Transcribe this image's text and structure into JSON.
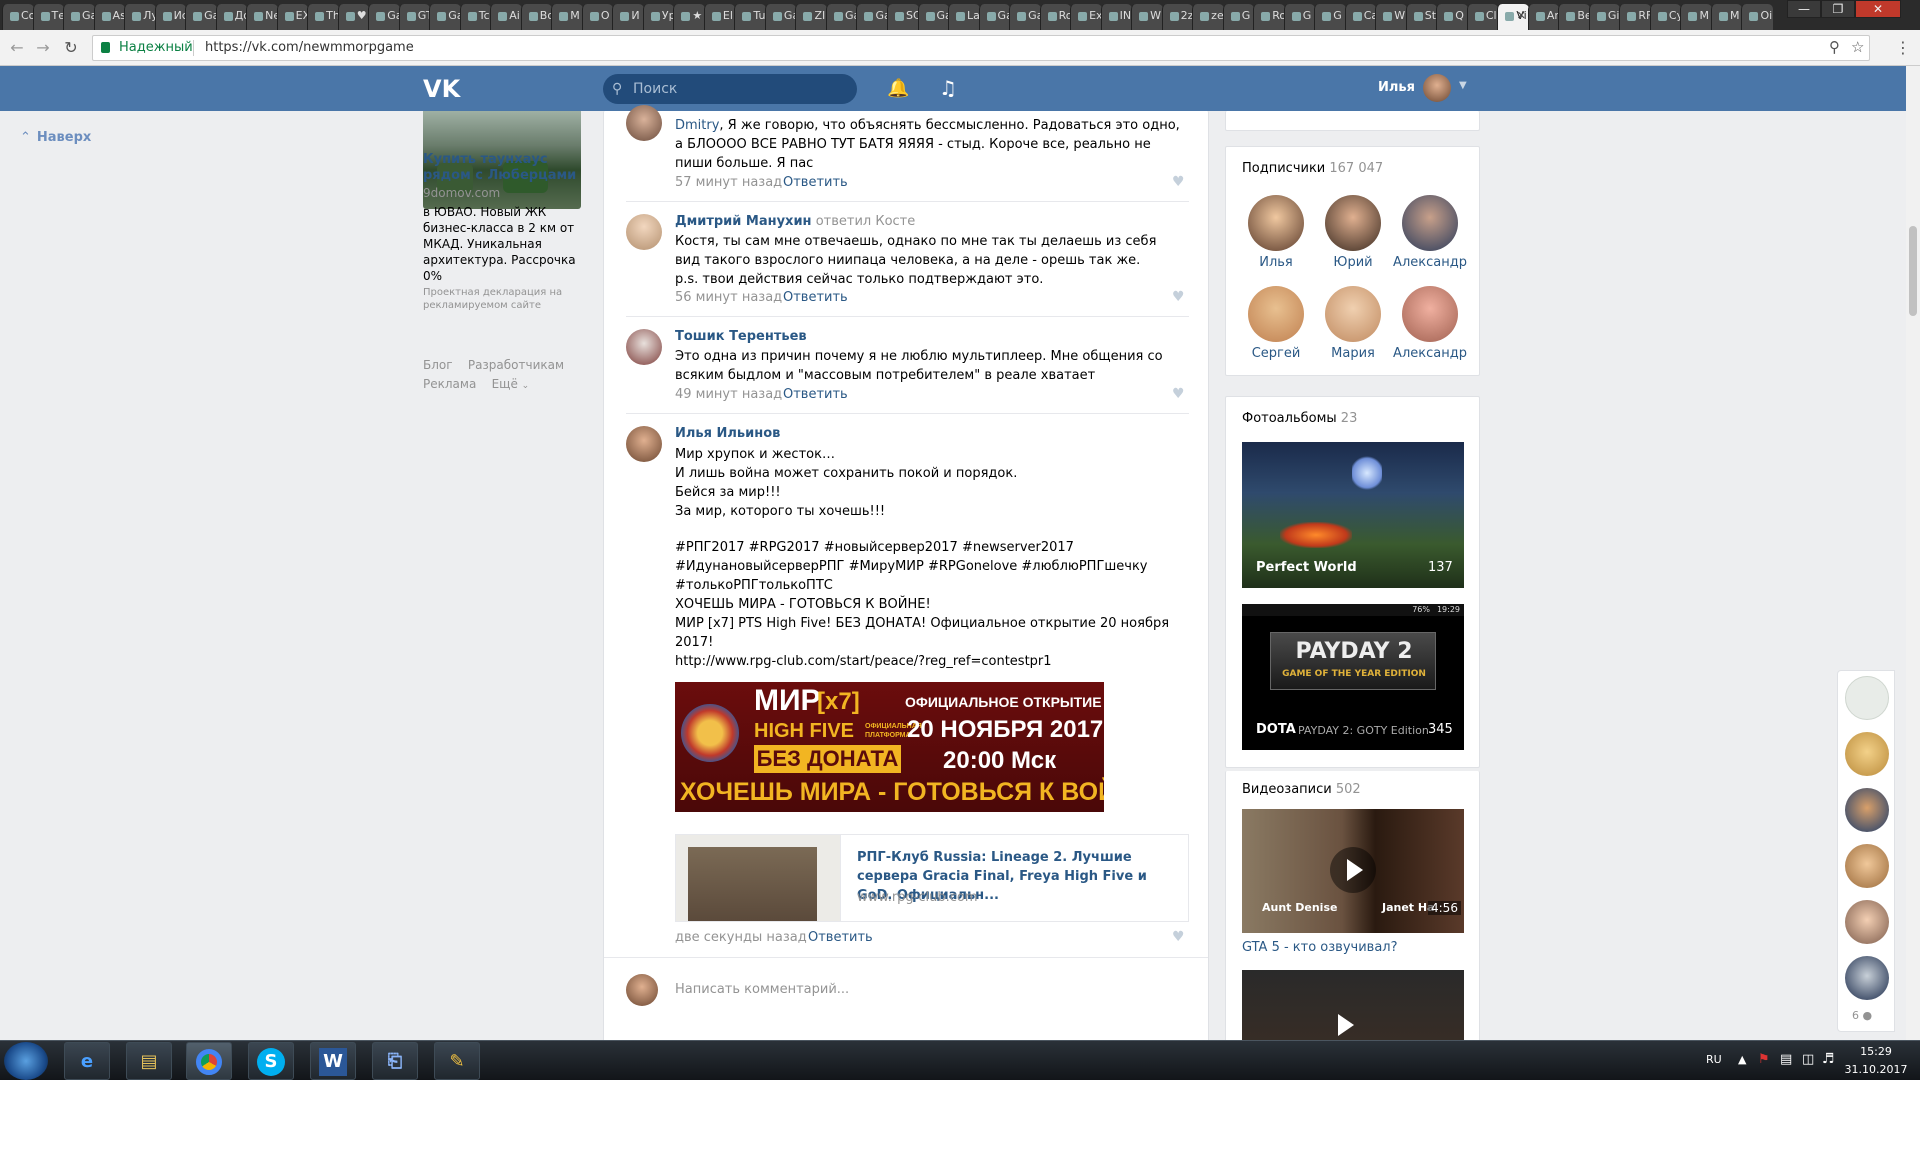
{
  "browser": {
    "tabs": [
      "Со",
      "Те",
      "Ga",
      "As",
      "Лу",
      "Ис",
      "Ga",
      "До",
      "Ne",
      "EX",
      "Th",
      "♥",
      "Ga",
      "GT",
      "Ga",
      "Tc",
      "Ai",
      "Bo",
      "M",
      "O",
      "И",
      "Ур",
      "★",
      "El",
      "Tu",
      "Ga",
      "ZI",
      "Ga",
      "Ga",
      "SC",
      "Ga",
      "La",
      "Ga",
      "Ga",
      "Ro",
      "Ex",
      "IN",
      "W",
      "2z",
      "ze",
      "G",
      "Ro",
      "G",
      "G",
      "Ca",
      "W",
      "St",
      "Q",
      "Cl",
      "Vi",
      "Ar",
      "Be",
      "Gi",
      "RF",
      "Cy",
      "M",
      "M",
      "Oi"
    ],
    "active_tab_index": 49,
    "secure_label": "Надежный",
    "url": "https://vk.com/newmmorpgame",
    "icons": {
      "back": "back-arrow-icon",
      "forward": "forward-arrow-icon",
      "reload": "reload-icon",
      "zoom": "zoom-icon",
      "star": "bookmark-star-icon",
      "menu": "menu-dots-icon"
    }
  },
  "vk": {
    "header": {
      "search_placeholder": "Поиск",
      "user_name": "Илья"
    },
    "back_to_top": "Наверх",
    "ad": {
      "title": "Купить таунхаус рядом с Люберцами",
      "domain": "9domov.com",
      "text": "в ЮВАО. Новый ЖК бизнес-класса в 2 км от МКАД. Уникальная архитектура. Рассрочка 0%",
      "disclaimer": "Проектная декларация на рекламируемом сайте"
    },
    "footer_links": [
      "Блог",
      "Разработчикам",
      "Реклама",
      "Ещё"
    ],
    "comments": [
      {
        "author": "Dmitry",
        "text_rest": ", Я же говорю, что объяснять бессмысленно. Радоваться это одно, а БЛОООО ВСЕ РАВНО ТУТ БАТЯ ЯЯЯЯ - стыд. Короче все, реально не пиши больше. Я пас",
        "time": "57 минут назад",
        "reply": "Ответить"
      },
      {
        "author": "Дмитрий Манухин",
        "replied": "ответил Косте",
        "text": "Костя, ты сам мне отвечаешь, однако по мне так ты делаешь из себя вид такого взрослого ниипаца человека, а на деле - орешь так же.",
        "ps": "p.s. твои действия сейчас только подтверждают это.",
        "time": "56 минут назад",
        "reply": "Ответить"
      },
      {
        "author": "Тошик Терентьев",
        "text": "Это одна из причин почему я не люблю мультиплеер. Мне общения со всяким быдлом и \"массовым потребителем\" в реале хватает",
        "time": "49 минут назад",
        "reply": "Ответить"
      },
      {
        "author": "Илья Ильинов",
        "lines": [
          "Мир хрупок и жесток…",
          "И лишь война может сохранить покой и порядок.",
          "Бейся за мир!!!",
          "За мир, которого ты хочешь!!!"
        ],
        "hashtags": "#РПГ2017 #RPG2017 #новыйсервер2017 #newserver2017 #ИдунановыйсерверРПГ #МируМИР #RPGonelove #люблюРПГшечку #толькоРПГтолькоПТС",
        "line_caps": "ХОЧЕШЬ МИРА - ГОТОВЬСЯ К ВОЙНЕ!",
        "line_info": "МИР [x7] PTS High Five! БЕЗ ДОНАТА! Официальное открытие 20 ноября 2017!",
        "link": "http://www.rpg-club.com/start/peace/?reg_ref=contestpr1",
        "banner": {
          "mir": "МИР",
          "x7": "[x7]",
          "high_five": "HIGH FIVE",
          "official_platform": "ОФИЦИАЛЬНАЯ ПЛАТФОРМА",
          "no_donate": "БЕЗ ДОНАТА",
          "opening": "ОФИЦИАЛЬНОЕ ОТКРЫТИЕ",
          "date": "20 НОЯБРЯ 2017",
          "time": "20:00 Мск",
          "slogan": "ХОЧЕШЬ МИРА - ГОТОВЬСЯ К ВОЙНЕ"
        },
        "snippet": {
          "title": "РПГ-Клуб Russia: Lineage 2. Лучшие сервера Gracia Final, Freya High Five и GoD. Официальн...",
          "domain": "www.rpg-club.com"
        },
        "time": "две секунды назад",
        "reply": "Ответить"
      }
    ],
    "write_comment_placeholder": "Написать комментарий...",
    "subscribers": {
      "title": "Подписчики",
      "count": "167 047",
      "people": [
        "Илья",
        "Юрий",
        "Александр",
        "Сергей",
        "Мария",
        "Александр"
      ]
    },
    "photo_albums": {
      "title": "Фотоальбомы",
      "count": "23",
      "albums": [
        {
          "name": "Perfect World",
          "count": "137"
        },
        {
          "name": "DOTA",
          "count": "345",
          "overlay_text": "PAYDAY 2: GOTY Edition",
          "game_title": "PAYDAY 2",
          "subtitle": "GAME OF THE YEAR EDITION",
          "phone_time": "19:29",
          "battery": "76%"
        }
      ]
    },
    "videos": {
      "title": "Видеозаписи",
      "count": "502",
      "items": [
        {
          "title": "GTA 5 - кто озвучивал?",
          "duration": "4:56",
          "caption_left": "Aunt Denise",
          "caption_right": "Janet Ha"
        }
      ]
    },
    "chat_bar": {
      "more_count": "6"
    }
  },
  "taskbar": {
    "lang": "RU",
    "time": "15:29",
    "date": "31.10.2017",
    "apps": [
      "start-orb",
      "internet-explorer",
      "file-explorer",
      "chrome",
      "skype",
      "word",
      "network-tool",
      "paint"
    ]
  }
}
